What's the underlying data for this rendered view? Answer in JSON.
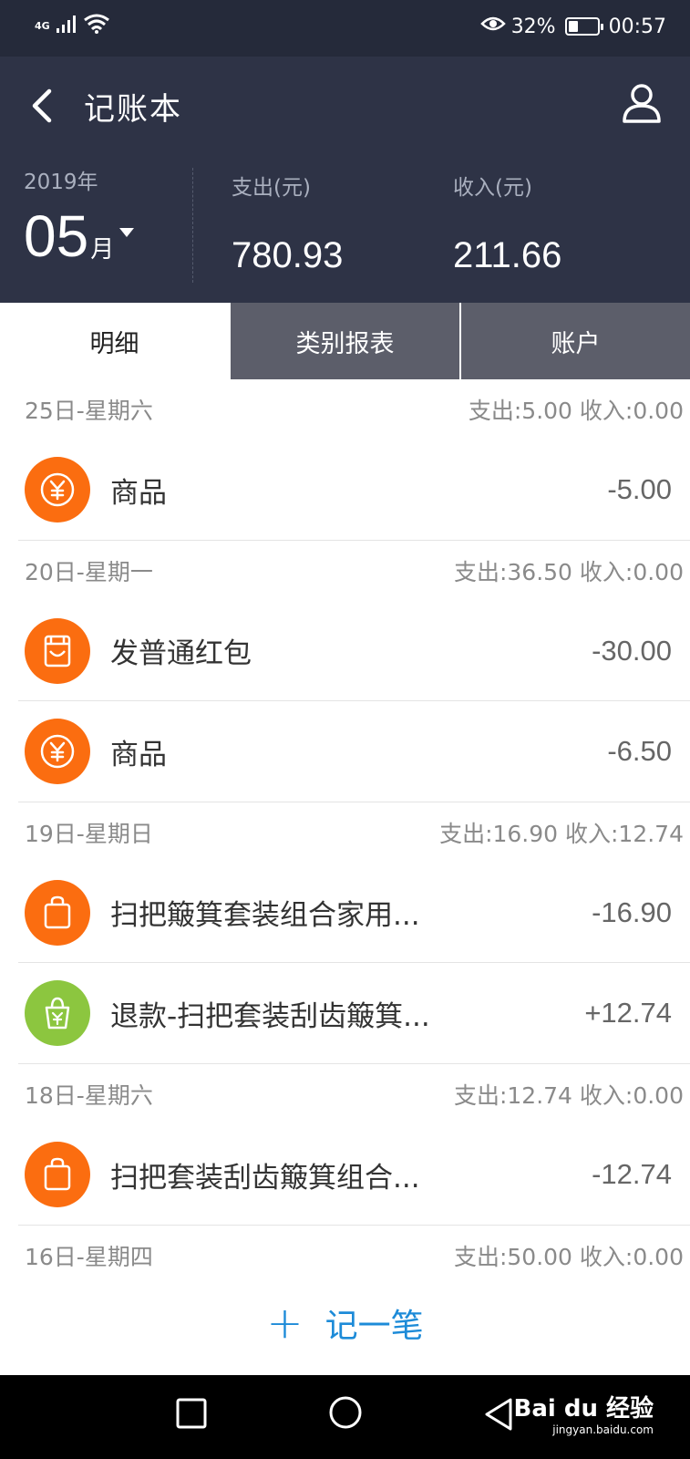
{
  "status_bar": {
    "network": "4G",
    "battery_percent": "32%",
    "battery_level": 0.32,
    "time": "00:57",
    "icons": [
      "signal-icon",
      "wifi-icon",
      "eye-icon",
      "battery-icon"
    ]
  },
  "header": {
    "title": "记账本",
    "year": "2019年",
    "month": "05",
    "month_unit": "月",
    "expense_label": "支出(元)",
    "expense_value": "780.93",
    "income_label": "收入(元)",
    "income_value": "211.66"
  },
  "tabs": [
    {
      "label": "明细",
      "active": true
    },
    {
      "label": "类别报表",
      "active": false
    },
    {
      "label": "账户",
      "active": false
    }
  ],
  "colors": {
    "orange": "#fb6d10",
    "green": "#8cc63f",
    "accent_blue": "#1d8bd8",
    "header_bg": "#2e3346"
  },
  "days": [
    {
      "date": "25日-星期六",
      "summary": "支出:5.00 收入:0.00",
      "items": [
        {
          "title": "商品",
          "amount": "-5.00",
          "icon": "yuan-coin-icon",
          "color": "orange"
        }
      ]
    },
    {
      "date": "20日-星期一",
      "summary": "支出:36.50 收入:0.00",
      "items": [
        {
          "title": "发普通红包",
          "amount": "-30.00",
          "icon": "red-envelope-icon",
          "color": "orange"
        },
        {
          "title": "商品",
          "amount": "-6.50",
          "icon": "yuan-coin-icon",
          "color": "orange"
        }
      ]
    },
    {
      "date": "19日-星期日",
      "summary": "支出:16.90 收入:12.74",
      "items": [
        {
          "title": "扫把簸箕套装组合家用...",
          "amount": "-16.90",
          "icon": "shopping-bag-icon",
          "color": "orange"
        },
        {
          "title": "退款-扫把套装刮齿簸箕...",
          "amount": "+12.74",
          "icon": "refund-bag-icon",
          "color": "green"
        }
      ]
    },
    {
      "date": "18日-星期六",
      "summary": "支出:12.74 收入:0.00",
      "items": [
        {
          "title": "扫把套装刮齿簸箕组合...",
          "amount": "-12.74",
          "icon": "shopping-bag-icon",
          "color": "orange"
        }
      ]
    },
    {
      "date": "16日-星期四",
      "summary": "支出:50.00 收入:0.00",
      "items": []
    }
  ],
  "add_button": {
    "plus": "+",
    "label": "记一笔"
  },
  "watermark": {
    "main": "Bai du 经验",
    "sub": "jingyan.baidu.com"
  }
}
